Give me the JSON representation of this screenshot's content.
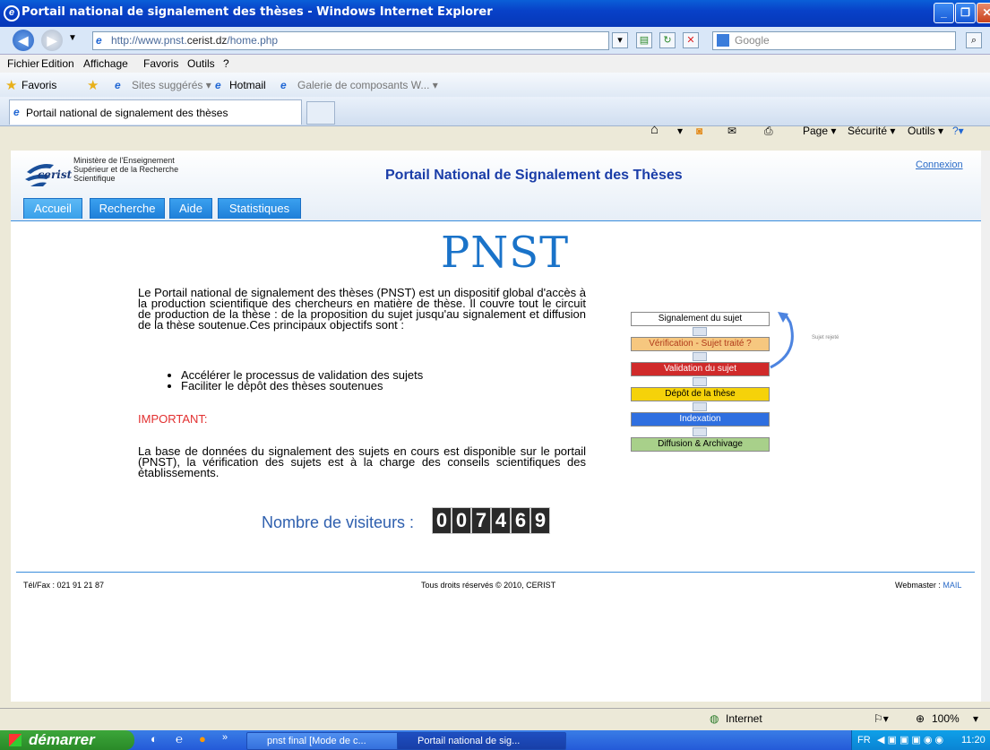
{
  "window": {
    "title": "Portail national de signalement des thèses - Windows Internet Explorer"
  },
  "address": {
    "url_prefix": "http://www.pnst.",
    "url_domain": "cerist.dz",
    "url_suffix": "/home.php",
    "search_placeholder": "Google"
  },
  "menu": [
    "Fichier",
    "Edition",
    "Affichage",
    "Favoris",
    "Outils",
    "?"
  ],
  "favorites": {
    "label": "Favoris",
    "items": [
      "Sites suggérés ▾",
      "Hotmail",
      "Galerie de composants W... ▾"
    ]
  },
  "tabs": {
    "active": "Portail national de signalement des thèses"
  },
  "commandbar": {
    "page": "Page ▾",
    "security": "Sécurité ▾",
    "tools": "Outils ▾"
  },
  "site": {
    "ministry": [
      "Ministère de l'Enseignement",
      "Supérieur et de la Recherche",
      "Scientifique"
    ],
    "logo_text": "cerist",
    "title": "Portail National de Signalement des Thèses",
    "connexion": "Connexion",
    "nav": [
      "Accueil",
      "Recherche",
      "Aide",
      "Statistiques"
    ],
    "pnst": "PNST",
    "intro": "Le Portail national de signalement des thèses (PNST) est un dispositif global d'accès à la production scientifique des chercheurs en matière de thèse. Il couvre tout le circuit de production de la thèse : de la proposition du sujet jusqu'au signalement et diffusion de la thèse soutenue.Ces principaux objectifs sont :",
    "bullets": [
      "Accélérer le processus de validation des sujets",
      "Faciliter le dépôt des thèses soutenues"
    ],
    "important": "IMPORTANT:",
    "para2": "La base de données du signalement des sujets en cours est disponible sur le portail (PNST), la vérification des sujets est à la charge des conseils scientifiques des établissements.",
    "visitors_label": "Nombre de visiteurs :",
    "visitor_digits": [
      "0",
      "0",
      "7",
      "4",
      "6",
      "9"
    ],
    "flow": [
      "Signalement du sujet",
      "Vérification - Sujet traité ?",
      "Validation du sujet",
      "Dépôt de la thèse",
      "Indexation",
      "Diffusion & Archivage"
    ],
    "flow_side": "Sujet rejeté",
    "footer_left": "Tél/Fax : 021 91 21 87",
    "footer_mid": "Tous droits réservés © 2010, CERIST",
    "footer_right_label": "Webmaster : ",
    "footer_right_link": "MAIL"
  },
  "status": {
    "zone": "Internet",
    "zoom": "100%"
  },
  "taskbar": {
    "start": "démarrer",
    "btn1": "pnst final [Mode de c...",
    "btn2": "Portail national de sig...",
    "lang": "FR",
    "time": "11:20"
  }
}
